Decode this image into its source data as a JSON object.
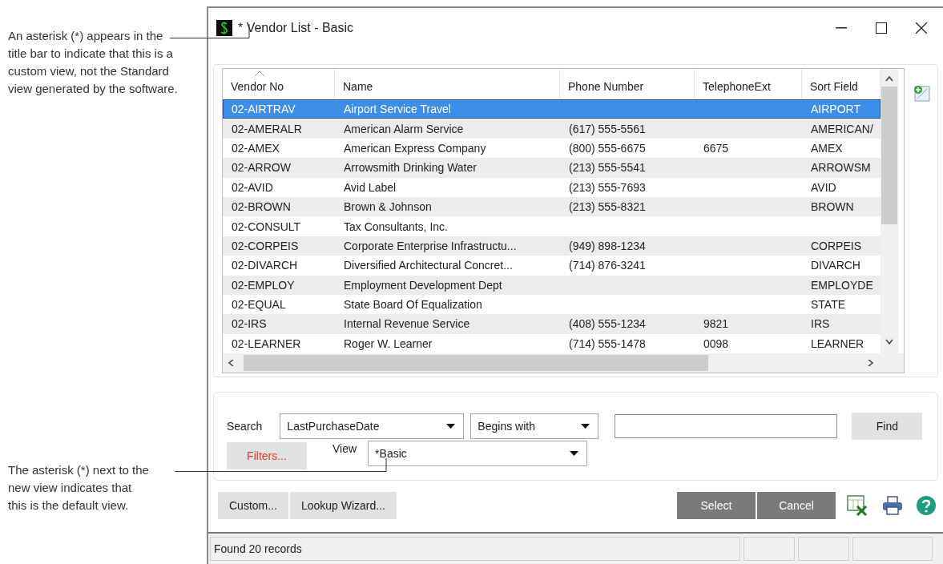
{
  "annotations": [
    {
      "text": "An asterisk (*) appears in the title bar to indicate that this is a custom view, not the Standard view generated by the software."
    },
    {
      "text": "The asterisk (*) next to the new view indicates that this is the default view."
    }
  ],
  "window": {
    "title": "* Vendor List - Basic"
  },
  "table": {
    "columns": [
      {
        "label": "Vendor No",
        "sorted": true
      },
      {
        "label": "Name",
        "sorted": false
      },
      {
        "label": "Phone Number",
        "sorted": false
      },
      {
        "label": "TelephoneExt",
        "sorted": false
      },
      {
        "label": "Sort Field",
        "sorted": false
      }
    ],
    "rows": [
      {
        "cells": [
          "02-AIRTRAV",
          "Airport Service Travel",
          "",
          "",
          "AIRPORT"
        ],
        "selected": true
      },
      {
        "cells": [
          "02-AMERALR",
          "American Alarm Service",
          "(617) 555-5561",
          "",
          "AMERICAN/"
        ],
        "selected": false
      },
      {
        "cells": [
          "02-AMEX",
          "American Express Company",
          "(800) 555-6675",
          "6675",
          "AMEX"
        ],
        "selected": false
      },
      {
        "cells": [
          "02-ARROW",
          "Arrowsmith Drinking Water",
          "(213) 555-5541",
          "",
          "ARROWSM"
        ],
        "selected": false
      },
      {
        "cells": [
          "02-AVID",
          "Avid Label",
          "(213) 555-7693",
          "",
          "AVID"
        ],
        "selected": false
      },
      {
        "cells": [
          "02-BROWN",
          "Brown & Johnson",
          "(213) 555-8321",
          "",
          "BROWN"
        ],
        "selected": false
      },
      {
        "cells": [
          "02-CONSULT",
          "Tax Consultants, Inc.",
          "",
          "",
          ""
        ],
        "selected": false
      },
      {
        "cells": [
          "02-CORPEIS",
          "Corporate Enterprise Infrastructu...",
          "(949) 898-1234",
          "",
          "CORPEIS"
        ],
        "selected": false
      },
      {
        "cells": [
          "02-DIVARCH",
          "Diversified Architectural Concret...",
          "(714) 876-3241",
          "",
          "DIVARCH"
        ],
        "selected": false
      },
      {
        "cells": [
          "02-EMPLOY",
          "Employment Development Dept",
          "",
          "",
          "EMPLOYDE"
        ],
        "selected": false
      },
      {
        "cells": [
          "02-EQUAL",
          "State Board Of Equalization",
          "",
          "",
          "STATE"
        ],
        "selected": false
      },
      {
        "cells": [
          "02-IRS",
          "Internal Revenue Service",
          "(408) 555-1234",
          "9821",
          "IRS"
        ],
        "selected": false
      },
      {
        "cells": [
          "02-LEARNER",
          "Roger W. Learner",
          "(714) 555-1478",
          "0098",
          "LEARNER"
        ],
        "selected": false
      }
    ]
  },
  "search": {
    "label": "Search",
    "field": "LastPurchaseDate",
    "operator": "Begins with",
    "find": "Find",
    "filters": "Filters...",
    "view_label": "View",
    "view": "*Basic"
  },
  "buttons": {
    "custom": "Custom...",
    "wizard": "Lookup Wizard...",
    "select": "Select",
    "cancel": "Cancel"
  },
  "status_bar": {
    "text": "Found 20 records"
  }
}
